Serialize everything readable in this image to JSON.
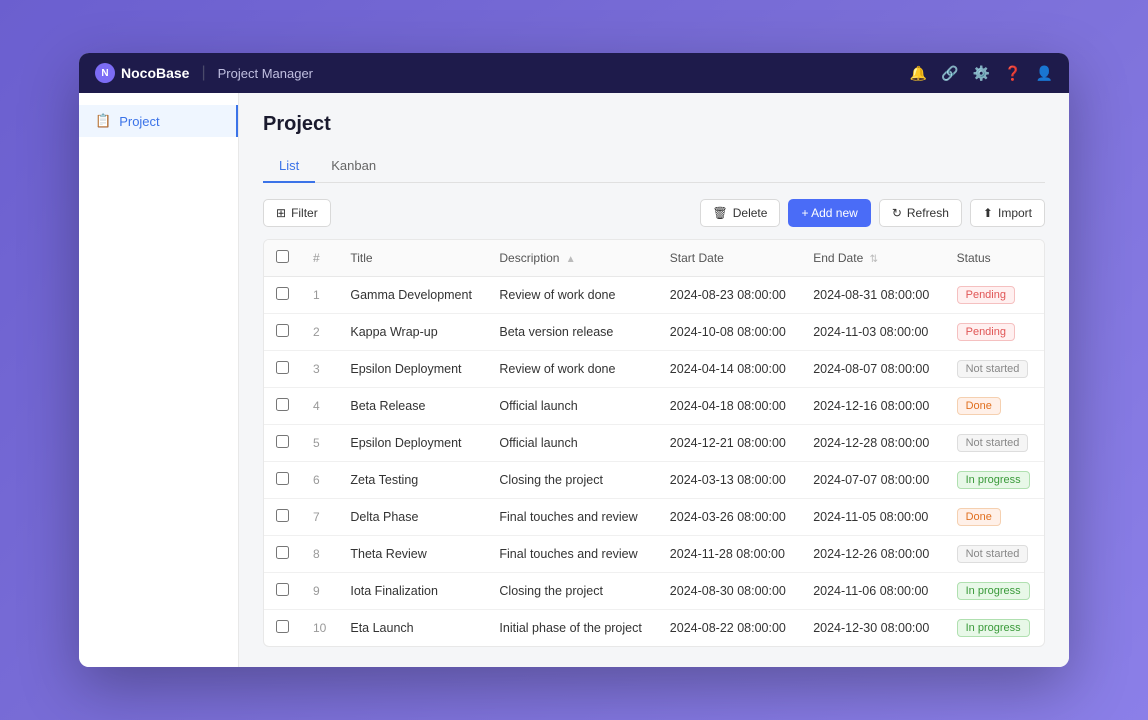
{
  "topnav": {
    "logo_text": "NocoBase",
    "app_name": "Project Manager"
  },
  "sidebar": {
    "items": [
      {
        "label": "Project",
        "active": true
      }
    ]
  },
  "page": {
    "title": "Project",
    "tabs": [
      "List",
      "Kanban"
    ],
    "active_tab": "List"
  },
  "toolbar": {
    "filter_label": "Filter",
    "delete_label": "Delete",
    "add_new_label": "+ Add new",
    "refresh_label": "Refresh",
    "import_label": "Import"
  },
  "table": {
    "columns": [
      "",
      "#",
      "Title",
      "Description",
      "Start Date",
      "End Date",
      "Status"
    ],
    "rows": [
      {
        "num": 1,
        "title": "Gamma Development",
        "description": "Review of work done",
        "start_date": "2024-08-23 08:00:00",
        "end_date": "2024-08-31 08:00:00",
        "status": "Pending",
        "status_type": "pending"
      },
      {
        "num": 2,
        "title": "Kappa Wrap-up",
        "description": "Beta version release",
        "start_date": "2024-10-08 08:00:00",
        "end_date": "2024-11-03 08:00:00",
        "status": "Pending",
        "status_type": "pending"
      },
      {
        "num": 3,
        "title": "Epsilon Deployment",
        "description": "Review of work done",
        "start_date": "2024-04-14 08:00:00",
        "end_date": "2024-08-07 08:00:00",
        "status": "Not started",
        "status_type": "not-started"
      },
      {
        "num": 4,
        "title": "Beta Release",
        "description": "Official launch",
        "start_date": "2024-04-18 08:00:00",
        "end_date": "2024-12-16 08:00:00",
        "status": "Done",
        "status_type": "done"
      },
      {
        "num": 5,
        "title": "Epsilon Deployment",
        "description": "Official launch",
        "start_date": "2024-12-21 08:00:00",
        "end_date": "2024-12-28 08:00:00",
        "status": "Not started",
        "status_type": "not-started"
      },
      {
        "num": 6,
        "title": "Zeta Testing",
        "description": "Closing the project",
        "start_date": "2024-03-13 08:00:00",
        "end_date": "2024-07-07 08:00:00",
        "status": "In progress",
        "status_type": "in-progress"
      },
      {
        "num": 7,
        "title": "Delta Phase",
        "description": "Final touches and review",
        "start_date": "2024-03-26 08:00:00",
        "end_date": "2024-11-05 08:00:00",
        "status": "Done",
        "status_type": "done"
      },
      {
        "num": 8,
        "title": "Theta Review",
        "description": "Final touches and review",
        "start_date": "2024-11-28 08:00:00",
        "end_date": "2024-12-26 08:00:00",
        "status": "Not started",
        "status_type": "not-started"
      },
      {
        "num": 9,
        "title": "Iota Finalization",
        "description": "Closing the project",
        "start_date": "2024-08-30 08:00:00",
        "end_date": "2024-11-06 08:00:00",
        "status": "In progress",
        "status_type": "in-progress"
      },
      {
        "num": 10,
        "title": "Eta Launch",
        "description": "Initial phase of the project",
        "start_date": "2024-08-22 08:00:00",
        "end_date": "2024-12-30 08:00:00",
        "status": "In progress",
        "status_type": "in-progress"
      }
    ]
  }
}
